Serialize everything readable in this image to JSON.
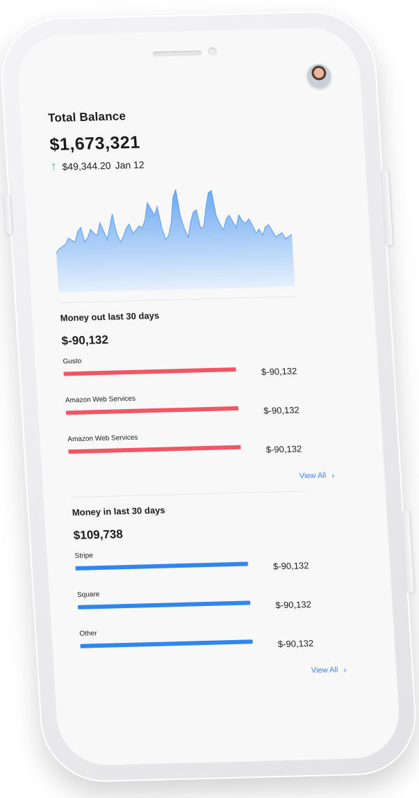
{
  "colors": {
    "accent": "#3b82f6",
    "money_out": "#f25563",
    "money_in": "#2f86f0",
    "positive": "#22b45a",
    "chart_fill_top": "#6aa8f2",
    "chart_fill_bottom": "#e6f0fc"
  },
  "header": {
    "avatar_icon": "avatar"
  },
  "balance": {
    "title": "Total Balance",
    "amount": "$1,673,321",
    "delta_icon": "arrow-up-icon",
    "delta_value": "$49,344.20",
    "delta_date": "Jan 12"
  },
  "chart_data": {
    "type": "area",
    "title": "",
    "xlabel": "",
    "ylabel": "",
    "ylim": [
      0,
      100
    ],
    "grid": false,
    "values": [
      38,
      42,
      44,
      46,
      52,
      50,
      48,
      58,
      62,
      48,
      52,
      60,
      56,
      54,
      66,
      58,
      50,
      62,
      74,
      55,
      47,
      52,
      60,
      64,
      55,
      58,
      62,
      60,
      68,
      84,
      78,
      72,
      80,
      60,
      48,
      52,
      64,
      88,
      96,
      70,
      58,
      50,
      64,
      74,
      76,
      58,
      60,
      78,
      92,
      94,
      70,
      62,
      56,
      66,
      70,
      64,
      58,
      70,
      64,
      62,
      66,
      60,
      52,
      56,
      50,
      58,
      60,
      54,
      48,
      50,
      52,
      46,
      48,
      50
    ]
  },
  "money_out": {
    "title": "Money out last 30 days",
    "amount": "$-90,132",
    "items": [
      {
        "label": "Gusto",
        "amount": "$-90,132",
        "fraction": 1.0
      },
      {
        "label": "Amazon Web Services",
        "amount": "$-90,132",
        "fraction": 1.0
      },
      {
        "label": "Amazon Web Services",
        "amount": "$-90,132",
        "fraction": 1.0
      }
    ],
    "view_all": "View All"
  },
  "money_in": {
    "title": "Money in last 30 days",
    "amount": "$109,738",
    "items": [
      {
        "label": "Stripe",
        "amount": "$-90,132",
        "fraction": 1.0
      },
      {
        "label": "Square",
        "amount": "$-90,132",
        "fraction": 1.0
      },
      {
        "label": "Other",
        "amount": "$-90,132",
        "fraction": 1.0
      }
    ],
    "view_all": "View All"
  }
}
